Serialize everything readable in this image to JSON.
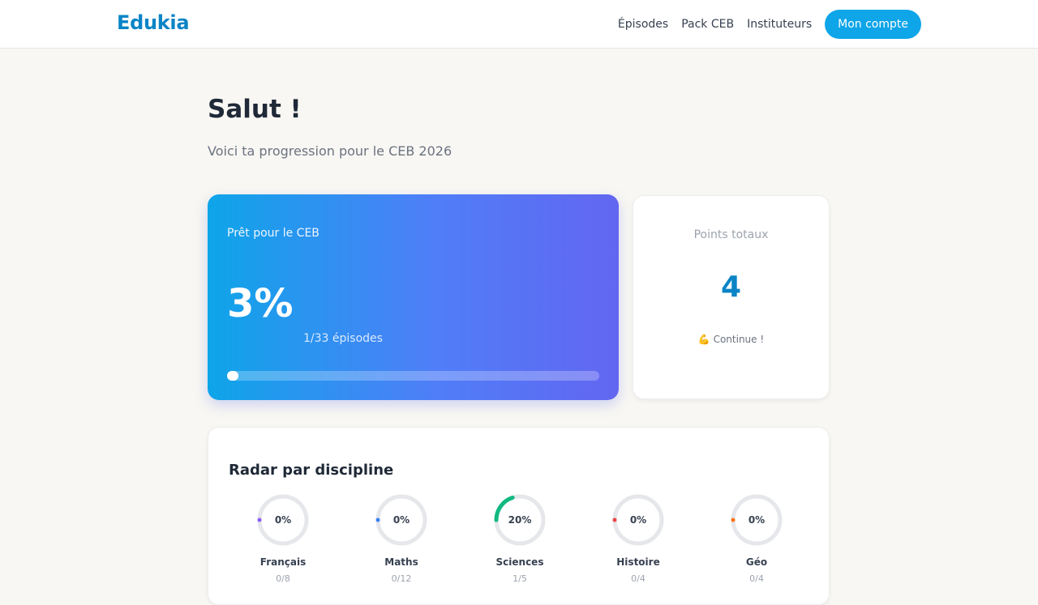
{
  "app": {
    "logo": "Edukia",
    "nav": {
      "episodes": "Épisodes",
      "pack": "Pack CEB",
      "teachers": "Instituteurs",
      "account": "Mon compte"
    }
  },
  "header": {
    "greeting": "Salut !",
    "subtitle": "Voici ta progression pour le CEB 2026"
  },
  "ready_card": {
    "label": "Prêt pour le CEB",
    "percent": "3%",
    "episodes": "1/33 épisodes",
    "progress": 0.03
  },
  "points_card": {
    "label": "Points totaux",
    "value": "4",
    "hint": "💪 Continue !"
  },
  "radar": {
    "title": "Radar par discipline",
    "subjects": [
      {
        "name": "Français",
        "percent_text": "0%",
        "count": "0/8",
        "progress": 0.0,
        "color": "#8b5cf6"
      },
      {
        "name": "Maths",
        "percent_text": "0%",
        "count": "0/12",
        "progress": 0.0,
        "color": "#3b82f6"
      },
      {
        "name": "Sciences",
        "percent_text": "20%",
        "count": "1/5",
        "progress": 0.2,
        "color": "#10b981"
      },
      {
        "name": "Histoire",
        "percent_text": "0%",
        "count": "0/4",
        "progress": 0.0,
        "color": "#ef4444"
      },
      {
        "name": "Géo",
        "percent_text": "0%",
        "count": "0/4",
        "progress": 0.0,
        "color": "#f97316"
      }
    ]
  }
}
